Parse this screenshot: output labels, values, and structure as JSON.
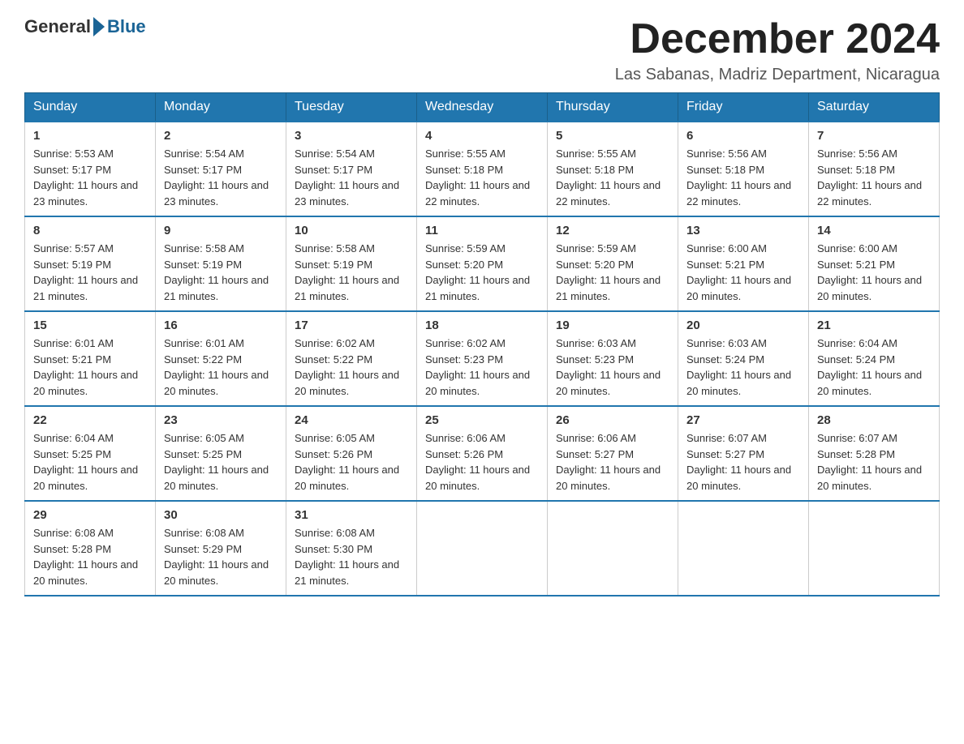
{
  "header": {
    "logo_general": "General",
    "logo_blue": "Blue",
    "month_title": "December 2024",
    "location": "Las Sabanas, Madriz Department, Nicaragua"
  },
  "weekdays": [
    "Sunday",
    "Monday",
    "Tuesday",
    "Wednesday",
    "Thursday",
    "Friday",
    "Saturday"
  ],
  "weeks": [
    [
      {
        "day": "1",
        "sunrise": "5:53 AM",
        "sunset": "5:17 PM",
        "daylight": "11 hours and 23 minutes."
      },
      {
        "day": "2",
        "sunrise": "5:54 AM",
        "sunset": "5:17 PM",
        "daylight": "11 hours and 23 minutes."
      },
      {
        "day": "3",
        "sunrise": "5:54 AM",
        "sunset": "5:17 PM",
        "daylight": "11 hours and 23 minutes."
      },
      {
        "day": "4",
        "sunrise": "5:55 AM",
        "sunset": "5:18 PM",
        "daylight": "11 hours and 22 minutes."
      },
      {
        "day": "5",
        "sunrise": "5:55 AM",
        "sunset": "5:18 PM",
        "daylight": "11 hours and 22 minutes."
      },
      {
        "day": "6",
        "sunrise": "5:56 AM",
        "sunset": "5:18 PM",
        "daylight": "11 hours and 22 minutes."
      },
      {
        "day": "7",
        "sunrise": "5:56 AM",
        "sunset": "5:18 PM",
        "daylight": "11 hours and 22 minutes."
      }
    ],
    [
      {
        "day": "8",
        "sunrise": "5:57 AM",
        "sunset": "5:19 PM",
        "daylight": "11 hours and 21 minutes."
      },
      {
        "day": "9",
        "sunrise": "5:58 AM",
        "sunset": "5:19 PM",
        "daylight": "11 hours and 21 minutes."
      },
      {
        "day": "10",
        "sunrise": "5:58 AM",
        "sunset": "5:19 PM",
        "daylight": "11 hours and 21 minutes."
      },
      {
        "day": "11",
        "sunrise": "5:59 AM",
        "sunset": "5:20 PM",
        "daylight": "11 hours and 21 minutes."
      },
      {
        "day": "12",
        "sunrise": "5:59 AM",
        "sunset": "5:20 PM",
        "daylight": "11 hours and 21 minutes."
      },
      {
        "day": "13",
        "sunrise": "6:00 AM",
        "sunset": "5:21 PM",
        "daylight": "11 hours and 20 minutes."
      },
      {
        "day": "14",
        "sunrise": "6:00 AM",
        "sunset": "5:21 PM",
        "daylight": "11 hours and 20 minutes."
      }
    ],
    [
      {
        "day": "15",
        "sunrise": "6:01 AM",
        "sunset": "5:21 PM",
        "daylight": "11 hours and 20 minutes."
      },
      {
        "day": "16",
        "sunrise": "6:01 AM",
        "sunset": "5:22 PM",
        "daylight": "11 hours and 20 minutes."
      },
      {
        "day": "17",
        "sunrise": "6:02 AM",
        "sunset": "5:22 PM",
        "daylight": "11 hours and 20 minutes."
      },
      {
        "day": "18",
        "sunrise": "6:02 AM",
        "sunset": "5:23 PM",
        "daylight": "11 hours and 20 minutes."
      },
      {
        "day": "19",
        "sunrise": "6:03 AM",
        "sunset": "5:23 PM",
        "daylight": "11 hours and 20 minutes."
      },
      {
        "day": "20",
        "sunrise": "6:03 AM",
        "sunset": "5:24 PM",
        "daylight": "11 hours and 20 minutes."
      },
      {
        "day": "21",
        "sunrise": "6:04 AM",
        "sunset": "5:24 PM",
        "daylight": "11 hours and 20 minutes."
      }
    ],
    [
      {
        "day": "22",
        "sunrise": "6:04 AM",
        "sunset": "5:25 PM",
        "daylight": "11 hours and 20 minutes."
      },
      {
        "day": "23",
        "sunrise": "6:05 AM",
        "sunset": "5:25 PM",
        "daylight": "11 hours and 20 minutes."
      },
      {
        "day": "24",
        "sunrise": "6:05 AM",
        "sunset": "5:26 PM",
        "daylight": "11 hours and 20 minutes."
      },
      {
        "day": "25",
        "sunrise": "6:06 AM",
        "sunset": "5:26 PM",
        "daylight": "11 hours and 20 minutes."
      },
      {
        "day": "26",
        "sunrise": "6:06 AM",
        "sunset": "5:27 PM",
        "daylight": "11 hours and 20 minutes."
      },
      {
        "day": "27",
        "sunrise": "6:07 AM",
        "sunset": "5:27 PM",
        "daylight": "11 hours and 20 minutes."
      },
      {
        "day": "28",
        "sunrise": "6:07 AM",
        "sunset": "5:28 PM",
        "daylight": "11 hours and 20 minutes."
      }
    ],
    [
      {
        "day": "29",
        "sunrise": "6:08 AM",
        "sunset": "5:28 PM",
        "daylight": "11 hours and 20 minutes."
      },
      {
        "day": "30",
        "sunrise": "6:08 AM",
        "sunset": "5:29 PM",
        "daylight": "11 hours and 20 minutes."
      },
      {
        "day": "31",
        "sunrise": "6:08 AM",
        "sunset": "5:30 PM",
        "daylight": "11 hours and 21 minutes."
      },
      null,
      null,
      null,
      null
    ]
  ],
  "labels": {
    "sunrise": "Sunrise:",
    "sunset": "Sunset:",
    "daylight": "Daylight:"
  }
}
